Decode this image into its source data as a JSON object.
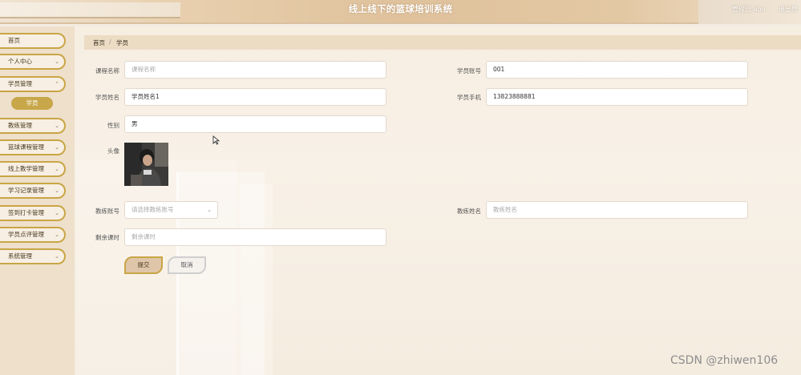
{
  "header": {
    "title": "线上线下的篮球培训系统",
    "user": "管理员 abo",
    "logout": "退出登"
  },
  "sidebar": {
    "items": [
      {
        "label": "首页",
        "chevron": false
      },
      {
        "label": "个人中心",
        "chevron": true
      },
      {
        "label": "学员管理",
        "chevron": true
      },
      {
        "label": "教练管理",
        "chevron": true
      },
      {
        "label": "篮球课程管理",
        "chevron": true
      },
      {
        "label": "线上教学管理",
        "chevron": true
      },
      {
        "label": "学习记录管理",
        "chevron": true
      },
      {
        "label": "签到打卡管理",
        "chevron": true
      },
      {
        "label": "学员点评管理",
        "chevron": true
      },
      {
        "label": "系统管理",
        "chevron": true
      }
    ],
    "sub_item": "学员"
  },
  "breadcrumb": {
    "home": "首页",
    "sep": "/",
    "current": "学员"
  },
  "form": {
    "course_name": {
      "label": "课程名称",
      "placeholder": "课程名称",
      "value": ""
    },
    "student_account": {
      "label": "学员账号",
      "value": "001"
    },
    "student_name": {
      "label": "学员姓名",
      "value": "学员姓名1"
    },
    "student_phone": {
      "label": "学员手机",
      "value": "13823888881"
    },
    "gender": {
      "label": "性别",
      "value": "男"
    },
    "avatar": {
      "label": "头像"
    },
    "coach_account": {
      "label": "教练账号",
      "placeholder": "请选择教练账号"
    },
    "coach_name": {
      "label": "教练姓名",
      "placeholder": "教练姓名"
    },
    "remaining_hours": {
      "label": "剩余课时",
      "placeholder": "剩余课时"
    }
  },
  "buttons": {
    "submit": "提交",
    "cancel": "取消"
  },
  "watermark": "CSDN @zhiwen106",
  "icons": {
    "chevron": "chevron-down-icon",
    "cursor": "mouse-cursor-icon"
  }
}
